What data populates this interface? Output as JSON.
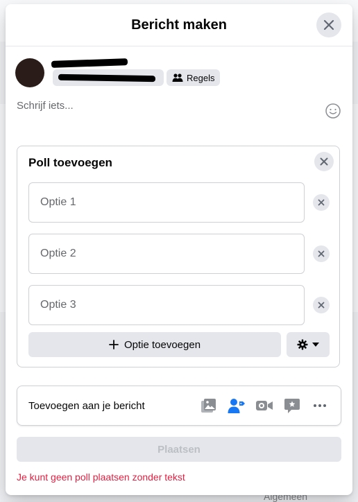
{
  "background": {
    "hint_text": "Algemeen"
  },
  "modal": {
    "title": "Bericht maken",
    "close_icon": "close-icon"
  },
  "author": {
    "rules_label": "Regels"
  },
  "composer": {
    "placeholder": "Schrijf iets...",
    "emoji_icon": "smiley-icon"
  },
  "poll": {
    "title": "Poll toevoegen",
    "options": [
      {
        "placeholder": "Optie 1",
        "value": ""
      },
      {
        "placeholder": "Optie 2",
        "value": ""
      },
      {
        "placeholder": "Optie 3",
        "value": ""
      }
    ],
    "add_option_label": "Optie toevoegen"
  },
  "add_to_post": {
    "label": "Toevoegen aan je bericht",
    "icons": [
      "photo-video-icon",
      "tag-people-icon",
      "live-video-icon",
      "feeling-icon",
      "more-icon"
    ],
    "accent_color": "#1877f2",
    "icon_color": "#8a8d91"
  },
  "submit": {
    "label": "Plaatsen",
    "enabled": false
  },
  "error": {
    "message": "Je kunt geen poll plaatsen zonder tekst",
    "color": "#e41e3f"
  }
}
